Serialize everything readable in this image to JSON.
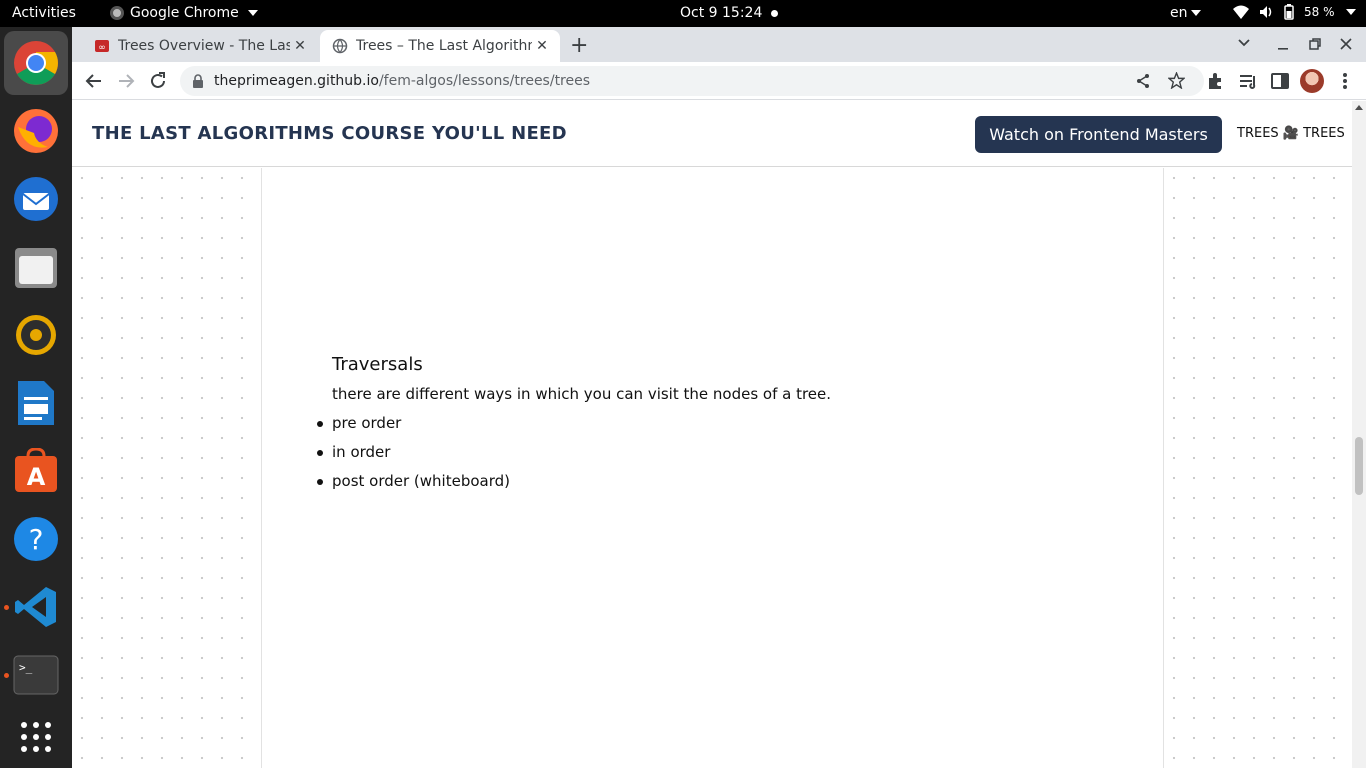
{
  "topbar": {
    "activities": "Activities",
    "app_name": "Google Chrome",
    "clock": "Oct 9  15:24",
    "language": "en",
    "battery": "58 %"
  },
  "dock": {
    "apps": [
      "chrome-icon",
      "firefox-icon",
      "thunderbird-icon",
      "files-icon",
      "rhythmbox-icon",
      "writer-icon",
      "software-icon",
      "help-icon",
      "vscode-icon",
      "terminal-icon",
      "app-grid-icon"
    ]
  },
  "browser": {
    "tabs": [
      {
        "title": "Trees Overview - The Last",
        "close": "✕"
      },
      {
        "title": "Trees – The Last Algorithm",
        "close": "✕"
      }
    ],
    "new_tab": "+",
    "address": {
      "host": "theprimeagen.github.io",
      "path": "/fem-algos/lessons/trees/trees"
    }
  },
  "site": {
    "title": "THE LAST ALGORITHMS COURSE YOU'LL NEED",
    "button": "Watch on Frontend Masters",
    "breadcrumb": "TREES 🎥 TREES"
  },
  "content": {
    "heading": "Traversals",
    "intro": "there are different ways in which you can visit the nodes of a tree.",
    "items": [
      "pre order",
      "in order",
      "post order (whiteboard)"
    ]
  },
  "colors": {
    "navy": "#253551",
    "tab_strip": "#dee1e6",
    "dock": "#242424",
    "ubuntu_orange": "#e95420"
  }
}
